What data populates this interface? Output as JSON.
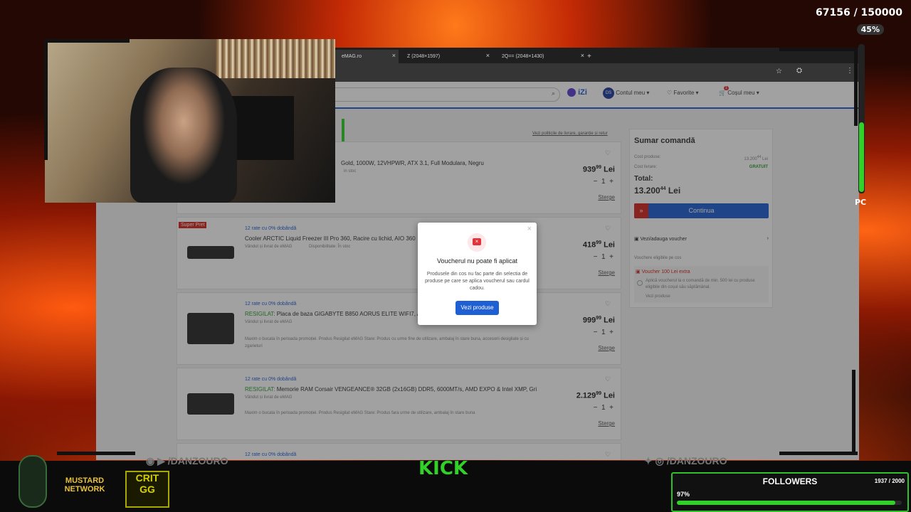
{
  "overlay": {
    "subgoal": "67156 / 150000",
    "subgoal_percent": "45%",
    "pc_label": "PC",
    "followers_label": "FOLLOWERS",
    "followers_count": "1937 / 2000",
    "followers_percent": "97%",
    "followers_fraction": 0.97,
    "social_left": "/DANZOURO",
    "social_right": "/DANZOURO",
    "kick_label": "KICK",
    "sponsor_1": "MUSTARD NETWORK",
    "sponsor_2": "CRIT GG"
  },
  "browser": {
    "tabs": [
      {
        "label": "eMAG.ro"
      },
      {
        "label": "Z (2048×1597)"
      },
      {
        "label": "2Q== (2048×1430)"
      }
    ],
    "new_tab": "+"
  },
  "header": {
    "genius": "iZi",
    "avatar": "DS",
    "account": "Contul meu",
    "favorites": "Favorite",
    "cart": "Coșul meu",
    "cart_badge": "1"
  },
  "cart": {
    "policies_link": "Vezi politicile de livrare, garanție și retur",
    "remove_label": "Sterge",
    "items": [
      {
        "badge": "",
        "installments": "",
        "prefix": "",
        "title": "Gold, 1000W, 12VHPWR, ATX 3.1, Full Modulara, Negru",
        "seller": "",
        "availability": "in stoc",
        "note": "",
        "price_int": "939",
        "price_dec": "99",
        "currency": "Lei",
        "qty": "1"
      },
      {
        "badge": "Super Pret",
        "installments": "12 rate cu 0% dobândă",
        "prefix": "",
        "title": "Cooler ARCTIC Liquid Freezer III Pro 360, Racire cu lichid, AIO 360",
        "seller": "Vândut și livrat de eMAG",
        "availability": "Disponibilitate: În stoc",
        "note": "",
        "price_int": "418",
        "price_dec": "99",
        "currency": "Lei",
        "qty": "1"
      },
      {
        "badge": "",
        "installments": "12 rate cu 0% dobândă",
        "prefix": "RESIGILAT:",
        "title": "Placa de baza GIGABYTE B850 AORUS ELITE WIFI7, AM",
        "seller": "Vândut și livrat de eMAG",
        "availability": "",
        "note": "Maxim o bucata în perioada promoției. Produs Resigilat eMAG Stare: Produs cu urme fine de utilizare, ambalaj în stare buna, accesorii desigilate și cu zgarieturi",
        "price_int": "999",
        "price_dec": "99",
        "currency": "Lei",
        "qty": "1"
      },
      {
        "badge": "",
        "installments": "12 rate cu 0% dobândă",
        "prefix": "RESIGILAT:",
        "title": "Memorie RAM Corsair VENGEANCE® 32GB (2x16GB) DDR5, 6000MT/s, AMD EXPO & Intel XMP, Gri",
        "seller": "Vândut și livrat de eMAG",
        "availability": "",
        "note": "Maxim o bucata în perioada promoției. Produs Resigilat eMAG Stare: Produs fara urme de utilizare, ambalaj în stare buna",
        "price_int": "2.129",
        "price_dec": "99",
        "currency": "Lei",
        "qty": "1"
      },
      {
        "badge": "",
        "installments": "12 rate cu 0% dobândă",
        "prefix": "",
        "title": "",
        "seller": "",
        "availability": "",
        "note": "",
        "price_int": "",
        "price_dec": "",
        "currency": "",
        "qty": ""
      }
    ]
  },
  "summary": {
    "title": "Sumar comandă",
    "cost_products_label": "Cost produse:",
    "cost_products_int": "13.200",
    "cost_products_dec": "44",
    "cost_products_currency": "Lei",
    "shipping_label": "Cost livrare:",
    "shipping_value": "GRATUIT",
    "total_label": "Total:",
    "total_int": "13.200",
    "total_dec": "44",
    "total_currency": "Lei",
    "continue": "Continua",
    "voucher_link": "Vezi/adauga voucher",
    "eligible_label": "Vouchere eligibile pe cos",
    "voucher_title": "Voucher 100 Lei extra",
    "voucher_desc": "Aplică voucherul la o comandă de min. 500 lei cu produse eligibile din coșul său săptămânal.",
    "voucher_products": "Vezi produse"
  },
  "modal": {
    "title": "Voucherul nu poate fi aplicat",
    "body": "Produsele din cos nu fac parte din selectia de produse pe care se aplica voucherul sau cardul cadou.",
    "button": "Vezi produse"
  },
  "colors": {
    "accent_blue": "#1f5fd4",
    "error_red": "#e2333a",
    "green": "#32d12a"
  }
}
